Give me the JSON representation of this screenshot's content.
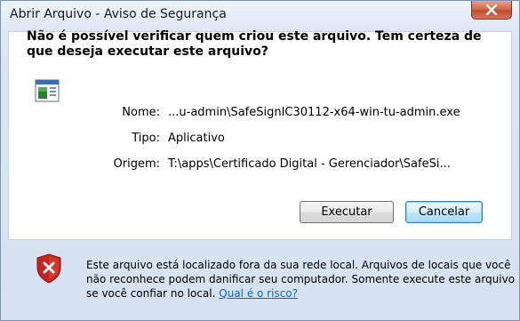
{
  "window": {
    "title": "Abrir Arquivo - Aviso de Segurança",
    "close_label": "X"
  },
  "dialog": {
    "headline": "Não é possível verificar quem criou este arquivo. Tem certeza de que deseja executar este arquivo?",
    "fields": [
      {
        "label": "Nome:",
        "value": "...u-admin\\SafeSignIC30112-x64-win-tu-admin.exe"
      },
      {
        "label": "Tipo:",
        "value": "Aplicativo"
      },
      {
        "label": "Origem:",
        "value": "T:\\apps\\Certificado Digital - Gerenciador\\SafeSi..."
      }
    ],
    "buttons": {
      "run": "Executar",
      "cancel": "Cancelar"
    }
  },
  "warning": {
    "text": "Este arquivo está localizado fora da sua rede local. Arquivos de locais que você não reconhece podem danificar seu computador. Somente execute este arquivo se você confiar no local.",
    "link": "Qual é o risco?"
  },
  "icons": {
    "file": "application-file-icon",
    "shield": "security-shield-error-icon",
    "close": "close-icon"
  },
  "colors": {
    "link": "#0066cc",
    "shield_red": "#c8231e",
    "close_button": "#c24a2c"
  }
}
